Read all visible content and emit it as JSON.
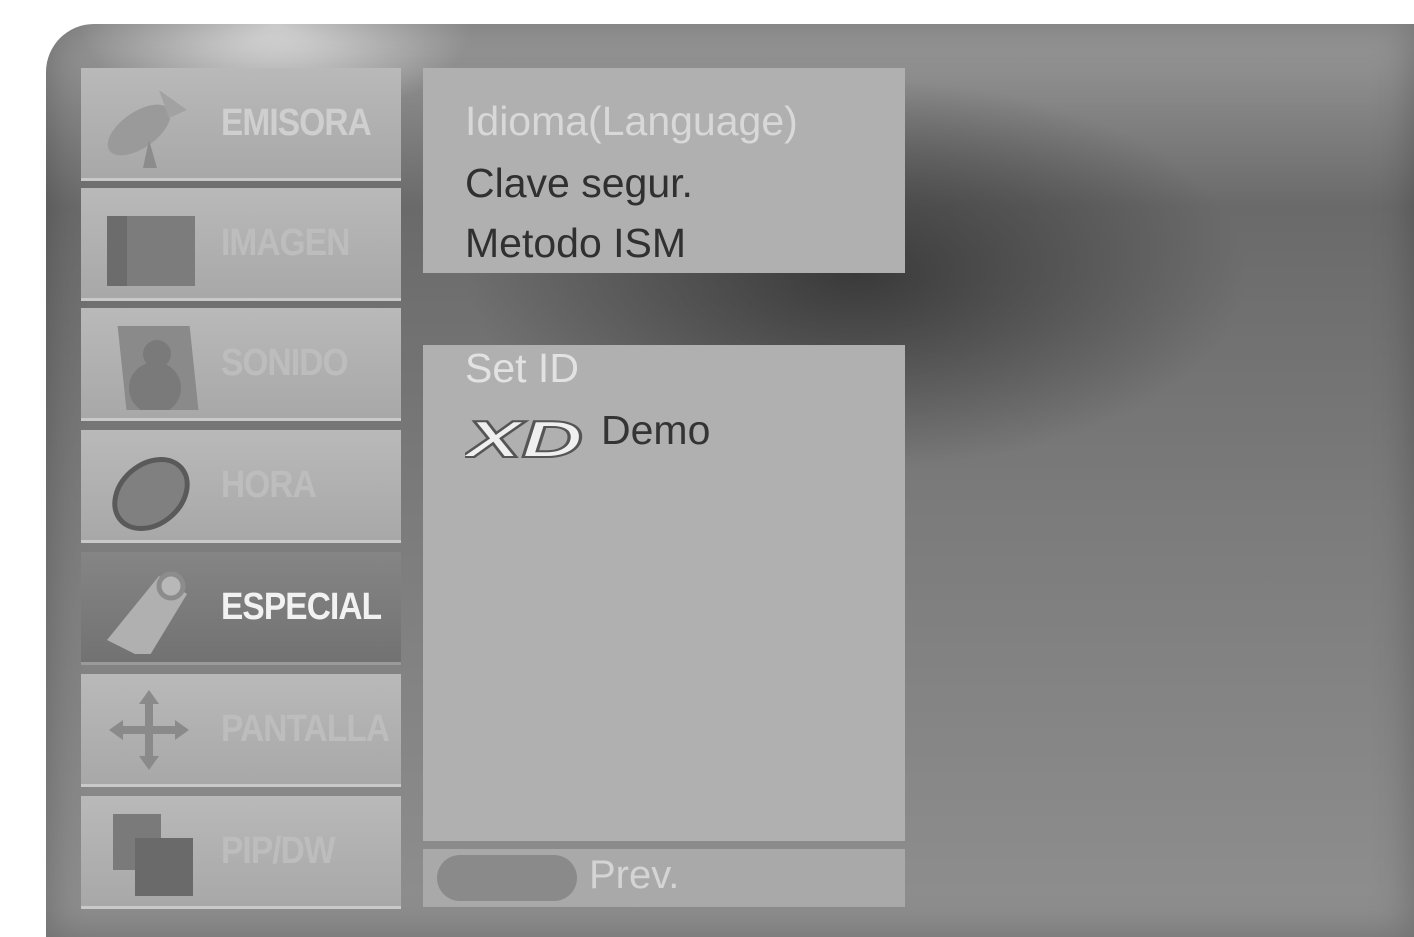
{
  "menu": {
    "items": [
      {
        "label": "EMISORA",
        "icon": "antenna-icon"
      },
      {
        "label": "IMAGEN",
        "icon": "picture-icon"
      },
      {
        "label": "SONIDO",
        "icon": "speaker-icon"
      },
      {
        "label": "HORA",
        "icon": "clock-icon"
      },
      {
        "label": "ESPECIAL",
        "icon": "tag-icon"
      },
      {
        "label": "PANTALLA",
        "icon": "move-arrows-icon"
      },
      {
        "label": "PIP/DW",
        "icon": "pip-windows-icon"
      }
    ],
    "selected": "ESPECIAL"
  },
  "submenu": {
    "top_options": [
      "Idioma(Language)",
      "Clave segur.",
      "Metodo ISM"
    ],
    "set_id_label": "Set ID",
    "xd_logo_text": "XD",
    "demo_label": "Demo"
  },
  "footer": {
    "prev_label": "Prev."
  }
}
